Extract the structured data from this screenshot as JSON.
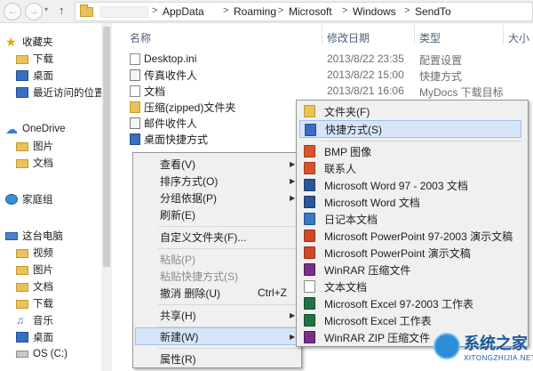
{
  "address": {
    "crumbs": [
      "AppData",
      "Roaming",
      "Microsoft",
      "Windows",
      "SendTo"
    ],
    "separator": ">"
  },
  "nav": {
    "favorites": "收藏夹",
    "downloads": "下载",
    "desktop": "桌面",
    "recent": "最近访问的位置",
    "onedrive": "OneDrive",
    "pictures": "图片",
    "documents": "文档",
    "homegroup": "家庭组",
    "thispc": "这台电脑",
    "videos": "视频",
    "pc_pictures": "图片",
    "pc_documents": "文档",
    "pc_downloads": "下载",
    "music": "音乐",
    "pc_desktop": "桌面",
    "osdrive": "OS (C:)"
  },
  "columns": {
    "name": "名称",
    "date": "修改日期",
    "type": "类型",
    "size": "大小"
  },
  "files": [
    {
      "name": "Desktop.ini",
      "date": "2013/8/22 23:35",
      "type": "配置设置"
    },
    {
      "name": "传真收件人",
      "date": "2013/8/22 15:00",
      "type": "快捷方式"
    },
    {
      "name": "文档",
      "date": "2013/8/21 16:06",
      "type": "MyDocs 下载目标"
    },
    {
      "name": "压缩(zipped)文件夹",
      "date": "",
      "type": ""
    },
    {
      "name": "邮件收件人",
      "date": "",
      "type": ""
    },
    {
      "name": "桌面快捷方式",
      "date": "",
      "type": ""
    }
  ],
  "context_menu": {
    "view": "查看(V)",
    "sort": "排序方式(O)",
    "group": "分组依据(P)",
    "refresh": "刷新(E)",
    "customize": "自定义文件夹(F)...",
    "paste": "粘贴(P)",
    "paste_shortcut": "粘贴快捷方式(S)",
    "undo": "撤消 删除(U)",
    "undo_shortcut": "Ctrl+Z",
    "share": "共享(H)",
    "new": "新建(W)",
    "properties": "属性(R)"
  },
  "new_submenu": [
    {
      "label": "文件夹(F)",
      "icon": "folder-icon",
      "color": "#e8c25a"
    },
    {
      "label": "快捷方式(S)",
      "icon": "shortcut-icon",
      "color": "#3a6fbf"
    },
    {
      "label": "BMP 图像",
      "icon": "bmp-image-icon",
      "color": "#d9542b"
    },
    {
      "label": "联系人",
      "icon": "contact-icon",
      "color": "#d9542b"
    },
    {
      "label": "Microsoft Word 97 - 2003 文档",
      "icon": "word-icon",
      "color": "#2b579a"
    },
    {
      "label": "Microsoft Word 文档",
      "icon": "word-icon",
      "color": "#2b579a"
    },
    {
      "label": "日记本文档",
      "icon": "journal-icon",
      "color": "#3a78c0"
    },
    {
      "label": "Microsoft PowerPoint 97-2003 演示文稿",
      "icon": "powerpoint-icon",
      "color": "#d24726"
    },
    {
      "label": "Microsoft PowerPoint 演示文稿",
      "icon": "powerpoint-icon",
      "color": "#d24726"
    },
    {
      "label": "WinRAR 压缩文件",
      "icon": "winrar-icon",
      "color": "#7a2f8a"
    },
    {
      "label": "文本文档",
      "icon": "text-document-icon",
      "color": "#ffffff"
    },
    {
      "label": "Microsoft Excel 97-2003 工作表",
      "icon": "excel-icon",
      "color": "#217346"
    },
    {
      "label": "Microsoft Excel 工作表",
      "icon": "excel-icon",
      "color": "#217346"
    },
    {
      "label": "WinRAR ZIP 压缩文件",
      "icon": "winrar-zip-icon",
      "color": "#7a2f8a"
    }
  ],
  "watermark": {
    "title": "系统之家",
    "url": "XITONGZHIJIA.NET"
  }
}
